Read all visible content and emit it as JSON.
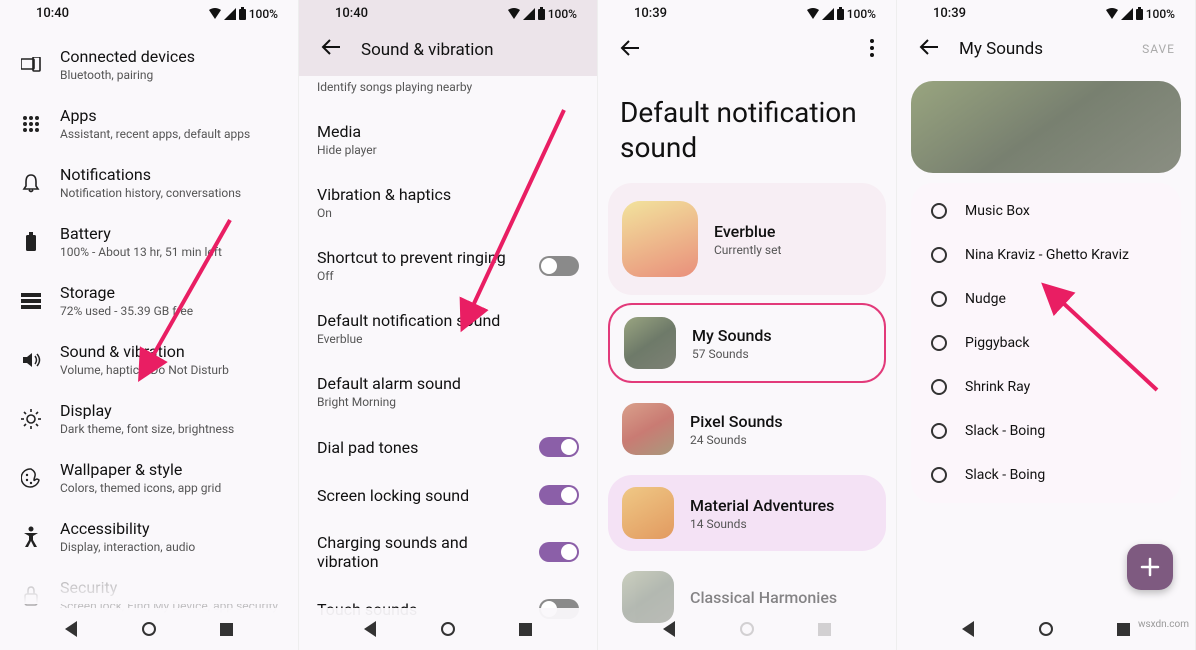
{
  "status": {
    "time_a": "10:40",
    "time_b": "10:40",
    "time_c": "10:39",
    "time_d": "10:39",
    "battery": "100%"
  },
  "panel1": {
    "items": [
      {
        "title": "Connected devices",
        "sub": "Bluetooth, pairing",
        "icon": "devices"
      },
      {
        "title": "Apps",
        "sub": "Assistant, recent apps, default apps",
        "icon": "apps"
      },
      {
        "title": "Notifications",
        "sub": "Notification history, conversations",
        "icon": "bell"
      },
      {
        "title": "Battery",
        "sub": "100% - About 13 hr, 51 min left",
        "icon": "battery"
      },
      {
        "title": "Storage",
        "sub": "72% used - 35.39 GB free",
        "icon": "storage"
      },
      {
        "title": "Sound & vibration",
        "sub": "Volume, haptics, Do Not Disturb",
        "icon": "volume"
      },
      {
        "title": "Display",
        "sub": "Dark theme, font size, brightness",
        "icon": "brightness"
      },
      {
        "title": "Wallpaper & style",
        "sub": "Colors, themed icons, app grid",
        "icon": "palette"
      },
      {
        "title": "Accessibility",
        "sub": "Display, interaction, audio",
        "icon": "accessibility"
      },
      {
        "title": "Security",
        "sub": "Screen lock, Find My Device, app security",
        "icon": "lock"
      }
    ]
  },
  "panel2": {
    "title": "Sound & vibration",
    "subheader_sub": "Identify songs playing nearby",
    "items": [
      {
        "label": "Media",
        "sub": "Hide player",
        "toggle": null
      },
      {
        "label": "Vibration & haptics",
        "sub": "On",
        "toggle": null
      },
      {
        "label": "Shortcut to prevent ringing",
        "sub": "Off",
        "toggle": false
      },
      {
        "label": "Default notification sound",
        "sub": "Everblue",
        "toggle": null
      },
      {
        "label": "Default alarm sound",
        "sub": "Bright Morning",
        "toggle": null
      },
      {
        "label": "Dial pad tones",
        "sub": "",
        "toggle": true
      },
      {
        "label": "Screen locking sound",
        "sub": "",
        "toggle": true
      },
      {
        "label": "Charging sounds and vibration",
        "sub": "",
        "toggle": true
      },
      {
        "label": "Touch sounds",
        "sub": "",
        "toggle": false
      }
    ]
  },
  "panel3": {
    "title": "Default notification sound",
    "cards": [
      {
        "label": "Everblue",
        "sub": "Currently set",
        "grad": "g-orange"
      },
      {
        "label": "My Sounds",
        "sub": "57 Sounds",
        "grad": "g-green"
      },
      {
        "label": "Pixel Sounds",
        "sub": "24 Sounds",
        "grad": "g-red"
      },
      {
        "label": "Material Adventures",
        "sub": "14 Sounds",
        "grad": "g-amber"
      },
      {
        "label": "Classical Harmonies",
        "sub": "",
        "grad": "g-green"
      }
    ]
  },
  "panel4": {
    "title": "My Sounds",
    "action": "SAVE",
    "sounds": [
      "Music Box",
      "Nina Kraviz - Ghetto Kraviz",
      "Nudge",
      "Piggyback",
      "Shrink Ray",
      "Slack - Boing",
      "Slack - Boing"
    ]
  },
  "watermark": "wsxdn.com"
}
